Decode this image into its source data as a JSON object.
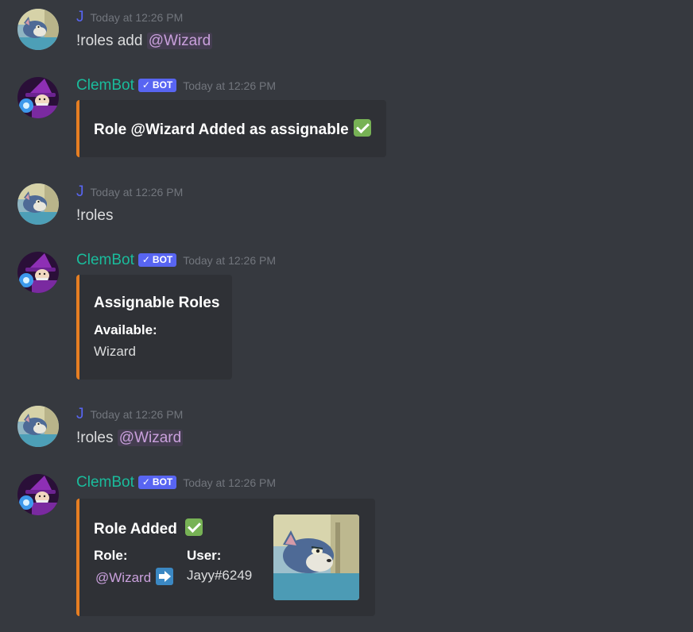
{
  "messages": [
    {
      "author": "J",
      "timestamp": "Today at 12:26 PM",
      "text_prefix": "!roles add ",
      "mention": "@Wizard"
    },
    {
      "author": "ClemBot",
      "bot_tag": "BOT",
      "timestamp": "Today at 12:26 PM",
      "embed": {
        "title": "Role @Wizard Added as assignable"
      }
    },
    {
      "author": "J",
      "timestamp": "Today at 12:26 PM",
      "text": "!roles"
    },
    {
      "author": "ClemBot",
      "bot_tag": "BOT",
      "timestamp": "Today at 12:26 PM",
      "embed": {
        "title": "Assignable Roles",
        "field_name": "Available:",
        "field_value": "Wizard"
      }
    },
    {
      "author": "J",
      "timestamp": "Today at 12:26 PM",
      "text_prefix": "!roles ",
      "mention": "@Wizard"
    },
    {
      "author": "ClemBot",
      "bot_tag": "BOT",
      "timestamp": "Today at 12:26 PM",
      "embed": {
        "title": "Role Added",
        "role_label": "Role:",
        "role_value": "@Wizard",
        "user_label": "User:",
        "user_value": "Jayy#6249"
      }
    }
  ],
  "colors": {
    "background": "#36393f",
    "embed_bg": "#2f3136",
    "embed_accent": "#e67e22",
    "user_name": "#5865f2",
    "bot_name": "#1abc9c",
    "bot_tag": "#5865f2",
    "mention": "#c9a0dc"
  },
  "icons": {
    "user_avatar": "cat-avatar-icon",
    "bot_avatar": "wizard-avatar-icon",
    "check": "check-mark-icon",
    "arrow": "right-arrow-icon"
  }
}
